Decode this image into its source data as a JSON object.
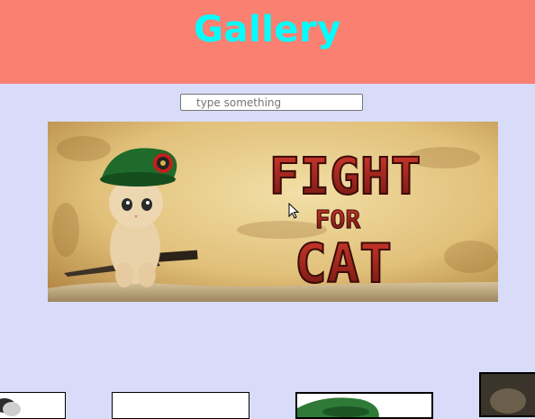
{
  "header": {
    "title": "Gallery"
  },
  "search": {
    "placeholder": "type something",
    "value": ""
  },
  "banner": {
    "title_line1": "FIGHT",
    "title_line2": "FOR",
    "title_line3": "CAT"
  },
  "colors": {
    "header_bg": "#fa8072",
    "title_color": "#00ffff",
    "page_bg": "#d9dcf8"
  }
}
